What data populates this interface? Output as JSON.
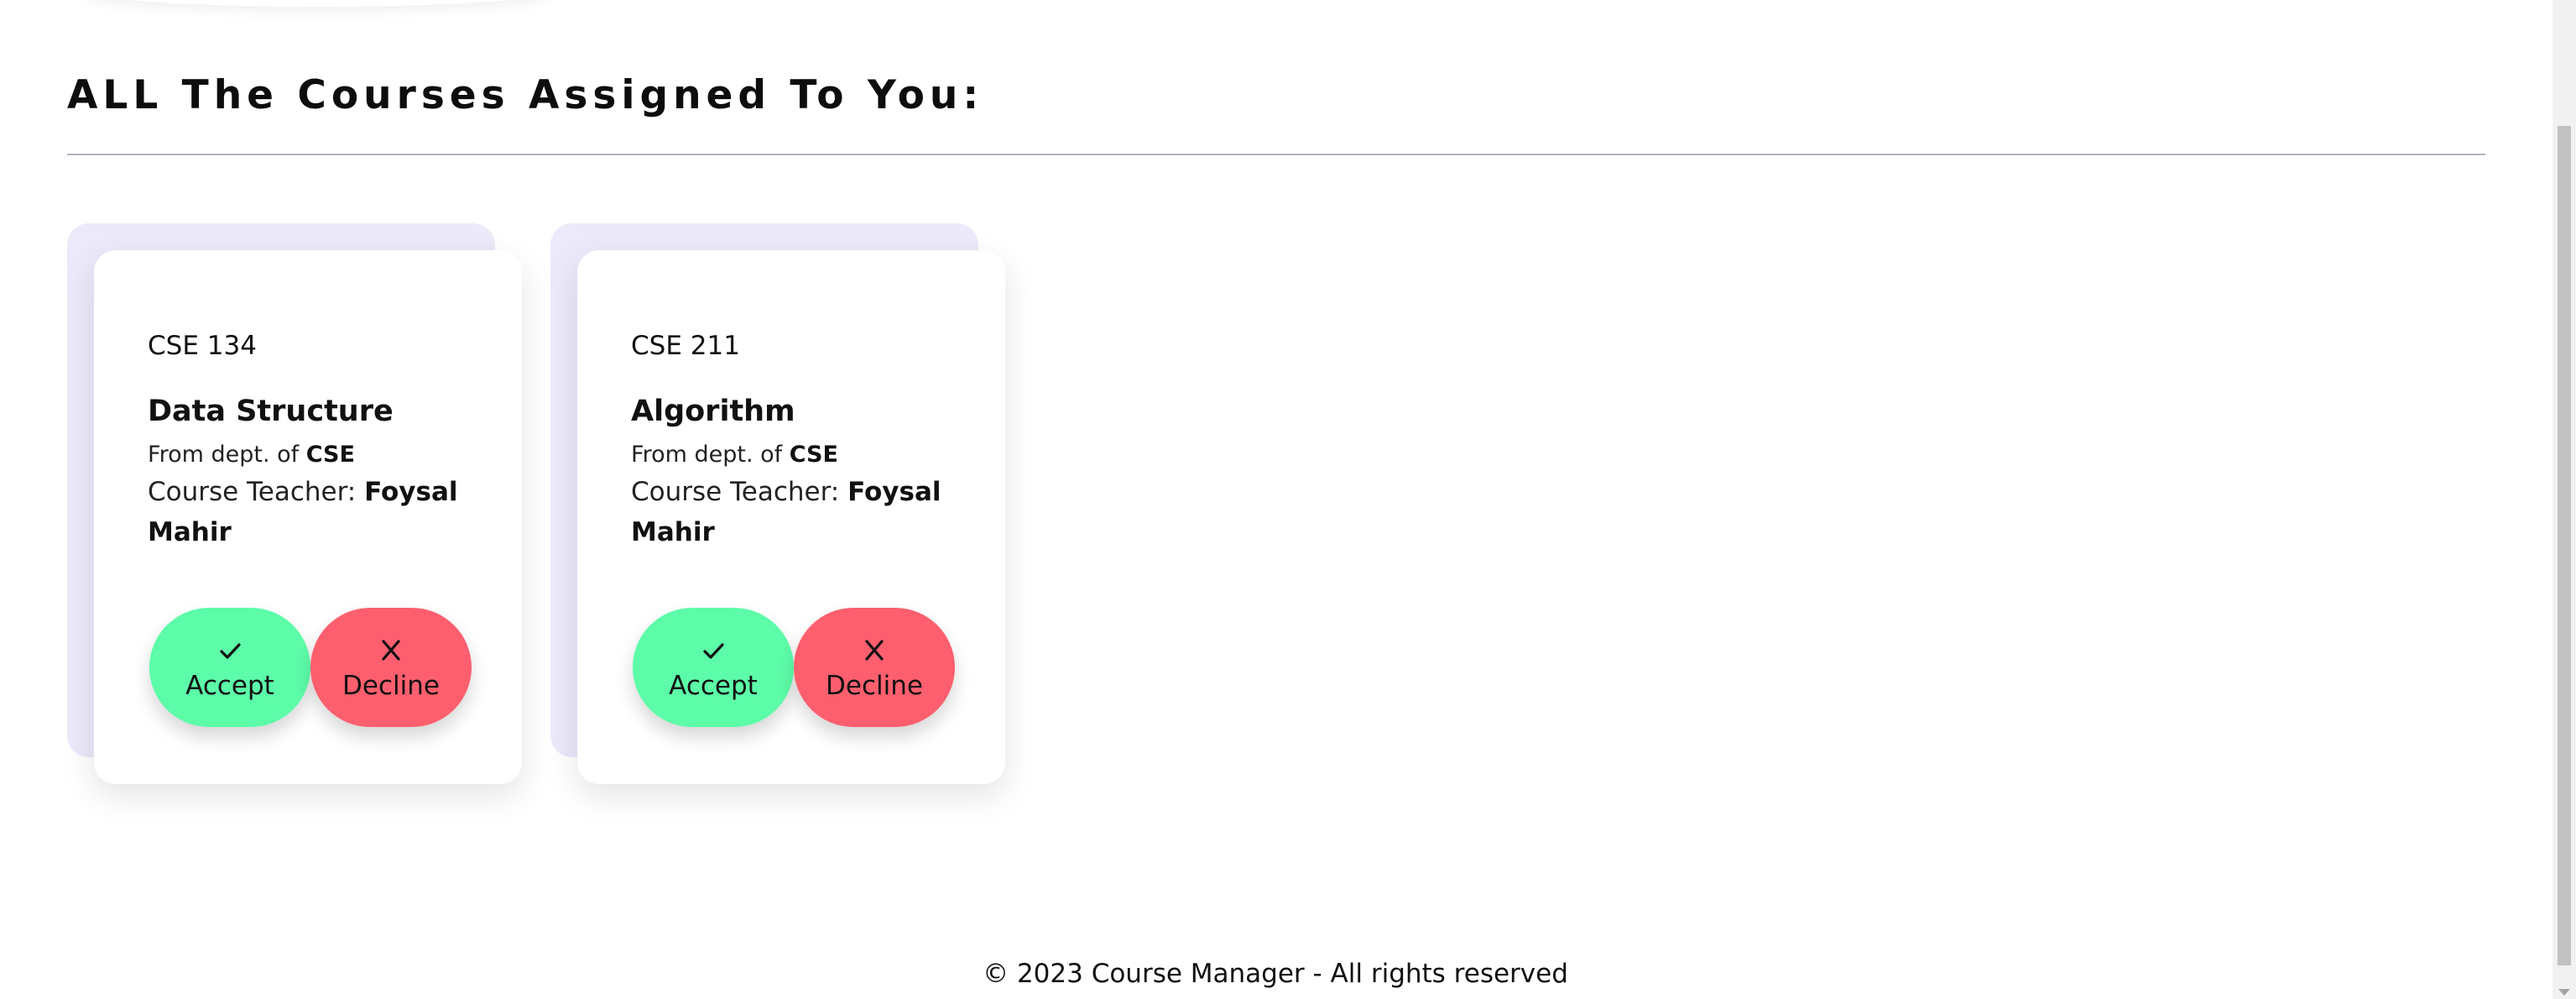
{
  "page": {
    "heading": "ALL The Courses Assigned To You:"
  },
  "courses": [
    {
      "code": "CSE 134",
      "title": "Data Structure",
      "dept_prefix": "From dept. of",
      "dept": "CSE",
      "teacher_label": "Course Teacher:",
      "teacher": "Foysal Mahir",
      "accept_label": "Accept",
      "decline_label": "Decline"
    },
    {
      "code": "CSE 211",
      "title": "Algorithm",
      "dept_prefix": "From dept. of",
      "dept": "CSE",
      "teacher_label": "Course Teacher:",
      "teacher": "Foysal Mahir",
      "accept_label": "Accept",
      "decline_label": "Decline"
    }
  ],
  "footer": {
    "text": "© 2023 Course Manager - All rights reserved"
  },
  "icons": {
    "accept": "check-icon",
    "decline": "x-icon"
  },
  "colors": {
    "accept": "#5cfca8",
    "decline": "#fd5f6e",
    "card_back": "#ece9fb"
  }
}
